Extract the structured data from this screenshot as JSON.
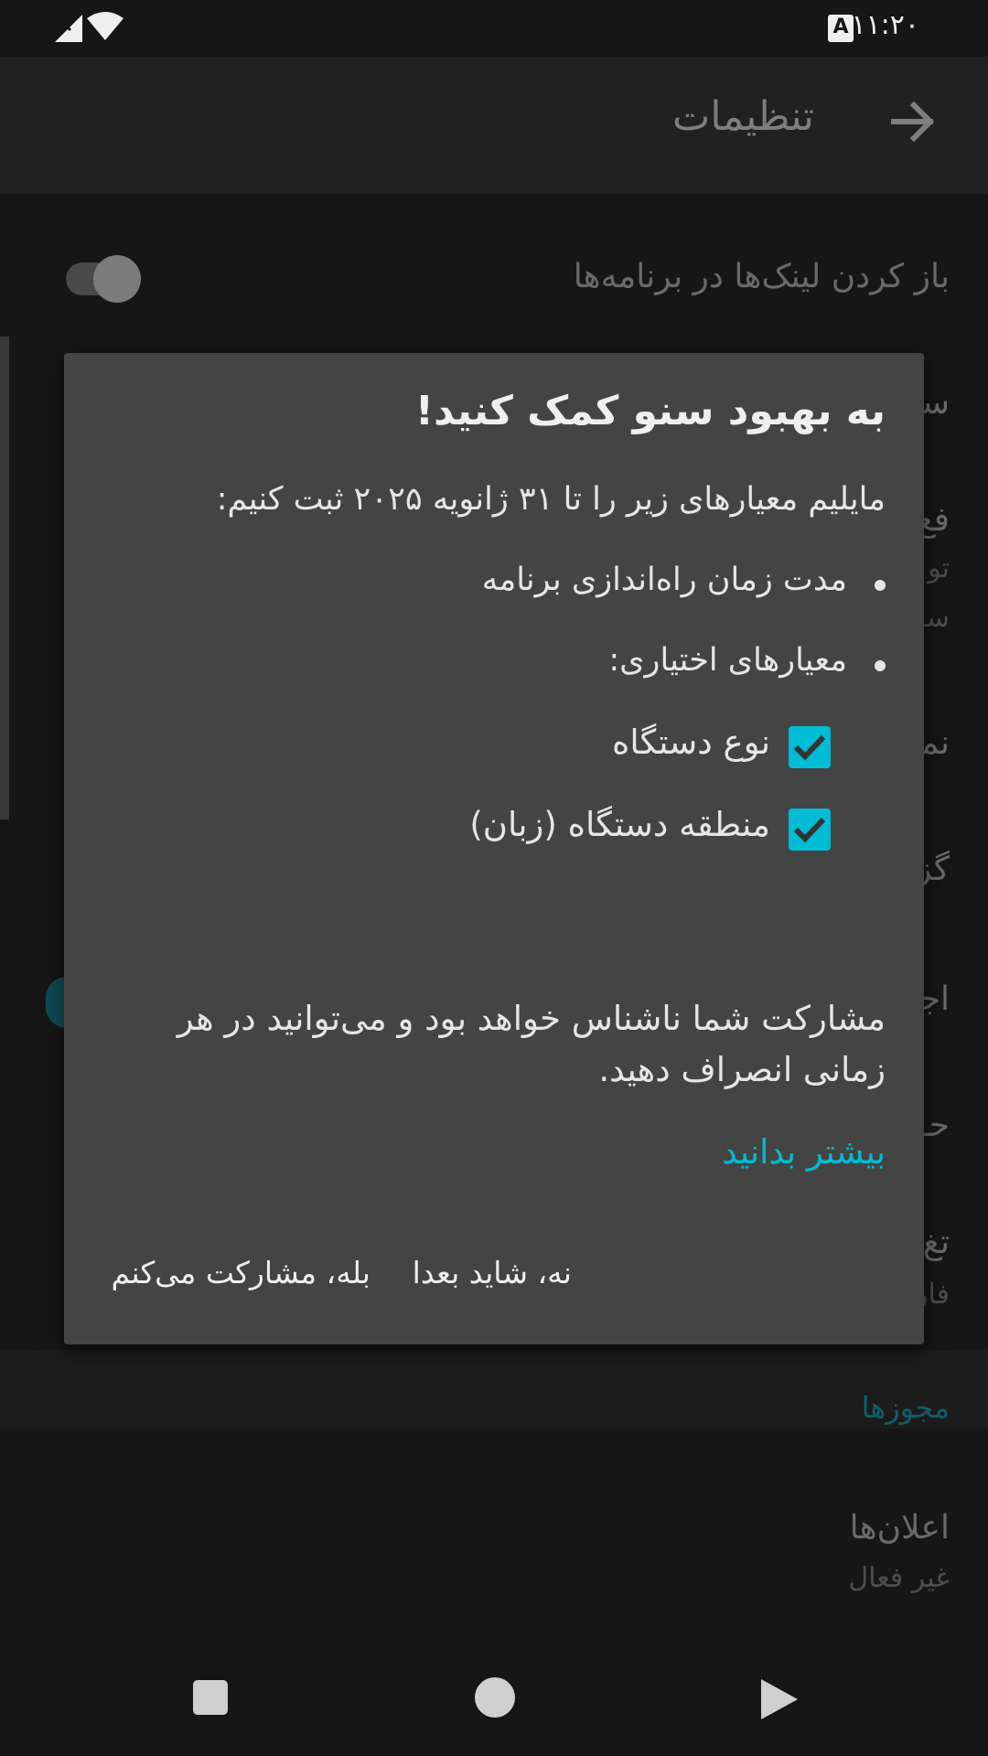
{
  "status_bar": {
    "time": "۱۱:۲۰",
    "notification_icon": "A"
  },
  "app_bar": {
    "title": "تنظیمات",
    "back_icon": "arrow-right-icon"
  },
  "settings": {
    "open_links_label": "باز کردن لینک‌ها در برنامه‌ها",
    "partial_rows": [
      {
        "text": "سن"
      },
      {
        "text": "فع"
      },
      {
        "text": "تو"
      },
      {
        "text": "سـ"
      },
      {
        "text": "نم"
      },
      {
        "text": "گز"
      },
      {
        "text": "اجـ"
      },
      {
        "text": "حـ"
      },
      {
        "text": "تغ"
      },
      {
        "text": "فار"
      }
    ],
    "section_header": "مجوزها",
    "notifications_label": "اعلان‌ها",
    "notifications_value": "غیر فعال"
  },
  "dialog": {
    "title": "به بهبود سنو کمک کنید!",
    "intro": "مایلیم معیارهای زیر را تا ۳۱ ژانویه ۲۰۲۵ ثبت کنیم:",
    "bullets": [
      "مدت زمان راه‌اندازی برنامه",
      "معیارهای اختیاری:"
    ],
    "options": [
      {
        "label": "نوع دستگاه",
        "checked": true
      },
      {
        "label": "منطقه دستگاه (زبان)",
        "checked": true
      }
    ],
    "anonymous_note": "مشارکت شما ناشناس خواهد بود و می‌توانید در هر زمانی انصراف دهید.",
    "learn_more": "بیشتر بدانید",
    "decline_button": "نه، شاید بعدا",
    "accept_button": "بله، مشارکت می‌کنم"
  },
  "colors": {
    "accent": "#00bcd4",
    "dialog_bg": "#444444",
    "background": "#161616"
  }
}
